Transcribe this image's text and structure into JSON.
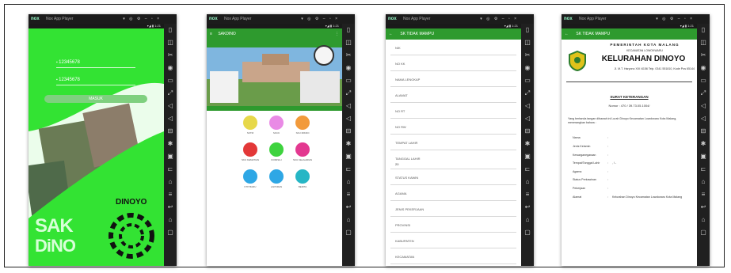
{
  "emulator": {
    "logo": "nox",
    "title": "Nox App Player",
    "window_controls": "▾ ◎ ⚙ – ▫ ×",
    "status": "▾◢ ▮ 1:21",
    "toolbar_icons": [
      "trash-icon",
      "camera-icon",
      "scissors-icon",
      "location-icon",
      "screen-icon",
      "expand-icon",
      "volume-up-icon",
      "volume-down-icon",
      "install-icon",
      "shake-icon",
      "record-icon",
      "share-icon",
      "more-icon",
      "menu-icon",
      "back-icon",
      "home-icon",
      "recent-icon"
    ]
  },
  "screen1": {
    "input1": "12345678",
    "input2": "12345678",
    "button": "MASUK",
    "brand_line1": "SAK",
    "brand_line2": "DiNO",
    "place": "DINOYO",
    "seal_text": "KELURAHAN KOTA MALANG"
  },
  "screen2": {
    "appbar": "SAKDINO",
    "menu": [
      {
        "label": "SKTM",
        "color": "#e7d84a"
      },
      {
        "label": "SKCK",
        "color": "#e98ae5"
      },
      {
        "label": "SKU MIKRO",
        "color": "#f29a3b"
      },
      {
        "label": "SKU KEMATIAN",
        "color": "#e33838"
      },
      {
        "label": "DOMISILI",
        "color": "#3ed33e"
      },
      {
        "label": "SKU KELAHIRAN",
        "color": "#e33890"
      },
      {
        "label": "KTP BARU",
        "color": "#2ea7e5"
      },
      {
        "label": "LAPORAN",
        "color": "#2ea7e5"
      },
      {
        "label": "BERITA",
        "color": "#26b6c5"
      }
    ]
  },
  "screen3": {
    "appbar": "SK TIDAK MAMPU",
    "fields": [
      "NIK",
      "NO KK",
      "NAMA LENGKAP",
      "ALAMAT",
      "NO RT",
      "NO RW",
      "TEMPAT LAHIR",
      "TANGGAL LAHIR",
      "STATUS KAWIN",
      "AGAMA",
      "JENIS PEKERJAAN",
      "PROVINSI",
      "KABUPATEN",
      "KECAMATAN"
    ],
    "tanggal_value": "20"
  },
  "screen4": {
    "appbar": "SK TIDAK MAMPU",
    "gov": "PEMERINTAH KOTA MALANG",
    "district": "KECAMATAN LOWOKWARU",
    "office": "KELURAHAN DINOYO",
    "address": "Jl. M.T. Haryono XIII /4156 Telp. 0341 551810, Kode Pos 65144",
    "letter_title": "SURAT KETERANGAN",
    "letter_number": "Nomor : 470 / 39.73.05.1004/",
    "intro": "Yang bertanda tangan dibawah ini Lurah Dinoyo Kecamatan Lowokwaru Kota Malang, menerangkan bahwa :",
    "rows": [
      {
        "label": "Nama",
        "value": ""
      },
      {
        "label": "Jenis Kelamin",
        "value": ""
      },
      {
        "label": "Kewarganegaraan",
        "value": ""
      },
      {
        "label": "Tempat/Tanggal Lahir",
        "value": ", / -"
      },
      {
        "label": "Agama",
        "value": ""
      },
      {
        "label": "Status Perkawinan",
        "value": ""
      },
      {
        "label": "Pekerjaan",
        "value": ""
      },
      {
        "label": "Alamat",
        "value": "Kelurahan Dinoyo Kecamatan Lowokwaru Kota Malang"
      }
    ]
  }
}
